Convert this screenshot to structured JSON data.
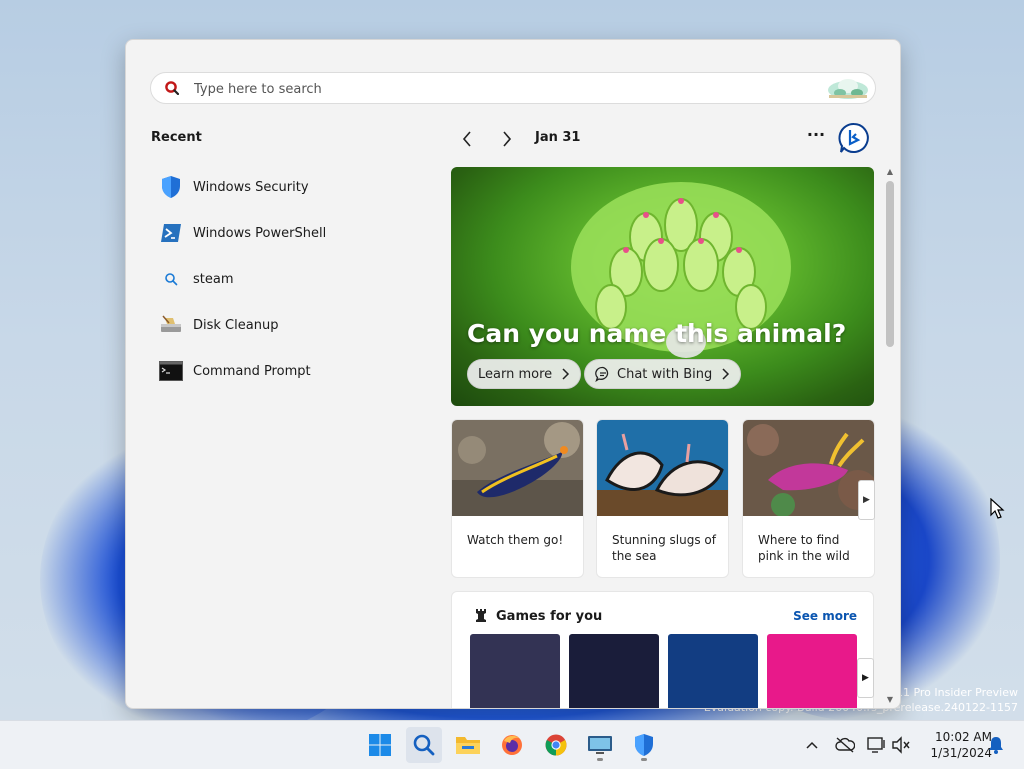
{
  "desktop": {
    "watermark_line1": "11 Pro Insider Preview",
    "watermark_line2": "Evaluation copy. Build 26040.rs_prerelease.240122-1157"
  },
  "search": {
    "placeholder": "Type here to search"
  },
  "recent": {
    "title": "Recent",
    "items": [
      {
        "label": "Windows Security",
        "icon": "shield-icon"
      },
      {
        "label": "Windows PowerShell",
        "icon": "powershell-icon"
      },
      {
        "label": "steam",
        "icon": "search-icon"
      },
      {
        "label": "Disk Cleanup",
        "icon": "disk-cleanup-icon"
      },
      {
        "label": "Command Prompt",
        "icon": "cmd-icon"
      }
    ]
  },
  "feed": {
    "date": "Jan 31",
    "more": "···",
    "hero": {
      "title": "Can you name this animal?",
      "learn_more": "Learn more",
      "chat": "Chat with Bing"
    },
    "cards": [
      {
        "caption": "Watch them go!"
      },
      {
        "caption": "Stunning slugs of the sea"
      },
      {
        "caption": "Where to find pink in the wild"
      }
    ],
    "games": {
      "title": "Games for you",
      "see_more": "See more"
    }
  },
  "clock": {
    "time": "10:02 AM",
    "date": "1/31/2024"
  },
  "colors": {
    "accent": "#0a55b0",
    "panel_bg": "#f3f3f3",
    "taskbar_bg": "#eef1f5"
  }
}
